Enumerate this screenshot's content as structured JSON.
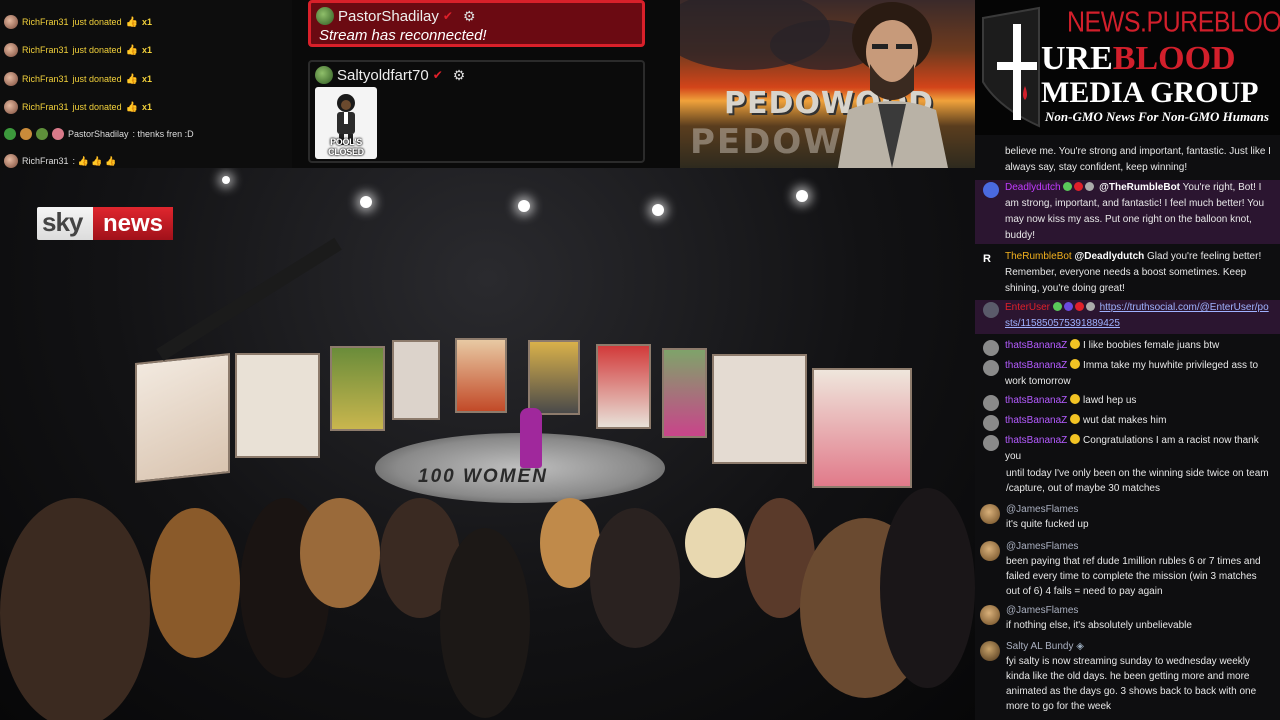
{
  "donations": [
    {
      "user": "RichFran31",
      "text": "just donated",
      "amount": "x1"
    },
    {
      "user": "RichFran31",
      "text": "just donated",
      "amount": "x1"
    },
    {
      "user": "RichFran31",
      "text": "just donated",
      "amount": "x1"
    },
    {
      "user": "RichFran31",
      "text": "just donated",
      "amount": "x1"
    }
  ],
  "feed_chat": [
    {
      "user": "PastorShadilay",
      "text": ": thenks fren :D"
    },
    {
      "user": "RichFran31",
      "text": ": 👍 👍 👍"
    }
  ],
  "alerts": {
    "reconnect": {
      "user": "PastorShadilay",
      "message": "Stream has reconnected!"
    },
    "user_alert": {
      "user": "Saltyoldfart70",
      "image_caption": "POOL'S CLOSED"
    }
  },
  "banner": {
    "title": "PEDOWOOD",
    "title_shadow": "PEDOWOOD"
  },
  "logo": {
    "url": "NEWS.PUREBLOOD.MEDIA",
    "line1_a": "URE",
    "line1_b": "BLOOD",
    "line2": "MEDIA GROUP",
    "tagline": "Non-GMO News For Non-GMO Humans"
  },
  "video": {
    "channel_logo_sky": "sky",
    "channel_logo_news": "news",
    "stage_text": "100 WOMEN"
  },
  "chat": {
    "messages": [
      {
        "text": "believe me. You're strong and important, fantastic. Just like I always say, stay confident, keep winning!"
      },
      {
        "user": "Deadlydutch",
        "mention": "@TheRumbleBot",
        "text": "You're right, Bot! I am strong, important, and fantastic! I feel much better! You may now kiss my ass. Put one right on the balloon knot, buddy!"
      },
      {
        "user": "TheRumbleBot",
        "mention": "@Deadlydutch",
        "text": "Glad you're feeling better! Remember, everyone needs a boost sometimes. Keep shining, you're doing great!"
      },
      {
        "user": "EnterUser",
        "link": "https://truthsocial.com/@EnterUser/posts/115850575391889425"
      },
      {
        "user": "thatsBananaZ",
        "text": "I like boobies female juans btw"
      },
      {
        "user": "thatsBananaZ",
        "text": "Imma take my huwhite privileged ass to work tomorrow"
      },
      {
        "user": "thatsBananaZ",
        "text": "lawd hep us"
      },
      {
        "user": "thatsBananaZ",
        "text": "wut dat makes him"
      },
      {
        "user": "thatsBananaZ",
        "text": "Congratulations I am a racist now thank you"
      }
    ],
    "lower": [
      {
        "text": "until today I've only been on the winning side twice on team /capture, out of maybe 30 matches"
      },
      {
        "user": "@JamesFlames",
        "text": "it's quite fucked up"
      },
      {
        "user": "@JamesFlames",
        "text": "been paying that ref dude 1million rubles 6 or 7 times and failed every time to complete the mission (win 3 matches out of 6) 4 fails = need to pay again"
      },
      {
        "user": "@JamesFlames",
        "text": "if nothing else, it's absolutely unbelievable"
      },
      {
        "user": "Salty AL Bundy",
        "text": "fyi salty is now streaming sunday to wednesday weekly kinda like the old days. he been getting more and more animated as the days go. 3 shows back to back with one more to go for the week"
      }
    ]
  }
}
